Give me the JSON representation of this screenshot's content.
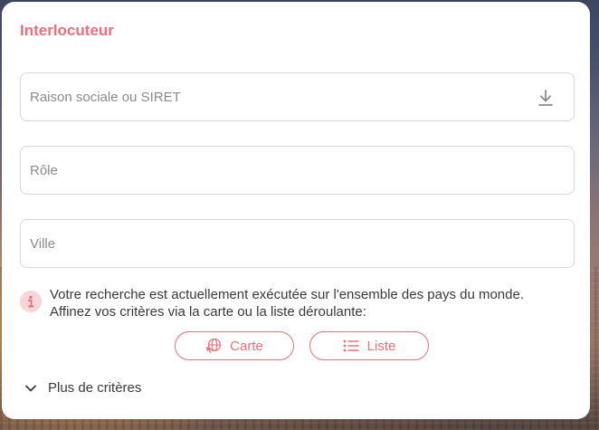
{
  "card": {
    "title": "Interlocuteur"
  },
  "fields": {
    "raison_sociale": {
      "placeholder": "Raison sociale ou SIRET",
      "value": ""
    },
    "role": {
      "placeholder": "Rôle",
      "value": ""
    },
    "ville": {
      "placeholder": "Ville",
      "value": ""
    }
  },
  "info": {
    "line1": "Votre recherche est actuellement exécutée sur l'ensemble des pays du monde.",
    "line2": "Affinez vos critères via la carte ou la liste déroulante:"
  },
  "buttons": {
    "carte": {
      "label": "Carte",
      "icon": "globe-cursor-icon"
    },
    "liste": {
      "label": "Liste",
      "icon": "list-icon"
    }
  },
  "more_criteria": {
    "label": "Plus de critères",
    "icon": "chevron-down-icon"
  },
  "colors": {
    "accent": "#e8707a",
    "info_bg": "#f7d6d8",
    "border": "#d7d7d7"
  }
}
